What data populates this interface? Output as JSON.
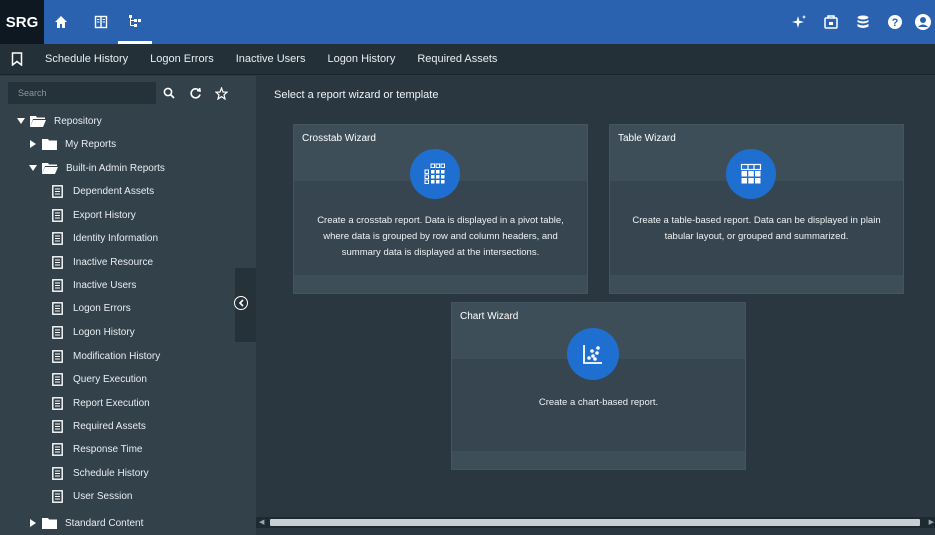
{
  "topbar": {
    "logo_text": "SRG",
    "left_icons": [
      "home-icon",
      "book-icon",
      "tree-icon"
    ],
    "right_icons": [
      "sparkle-icon",
      "package-icon",
      "database-icon",
      "help-icon",
      "user-icon"
    ],
    "bg_color": "#2a62b0"
  },
  "tabs": {
    "items": [
      "Schedule History",
      "Logon Errors",
      "Inactive Users",
      "Logon History",
      "Required Assets"
    ]
  },
  "sidebar": {
    "search_placeholder": "Search",
    "tree": {
      "repository": "Repository",
      "my_reports": "My Reports",
      "builtin_admin": "Built-in Admin Reports",
      "reports": [
        "Dependent Assets",
        "Export History",
        "Identity Information",
        "Inactive Resource",
        "Inactive Users",
        "Logon Errors",
        "Logon History",
        "Modification History",
        "Query Execution",
        "Report Execution",
        "Required Assets",
        "Response Time",
        "Schedule History",
        "User Session"
      ],
      "standard_content": "Standard Content"
    }
  },
  "main": {
    "title": "Select a report wizard or template",
    "cards": {
      "crosstab": {
        "title": "Crosstab Wizard",
        "icon": "grid-icon",
        "description": "Create a crosstab report. Data is displayed in a pivot table, where data is grouped by row and column headers, and summary data is displayed at the intersections."
      },
      "table": {
        "title": "Table Wizard",
        "icon": "table-icon",
        "description": "Create a table-based report. Data can be displayed in plain tabular layout, or grouped and summarized."
      },
      "chart": {
        "title": "Chart Wizard",
        "icon": "scatter-chart-icon",
        "description": "Create a chart-based report."
      }
    },
    "accent_color": "#1f6fd1"
  }
}
